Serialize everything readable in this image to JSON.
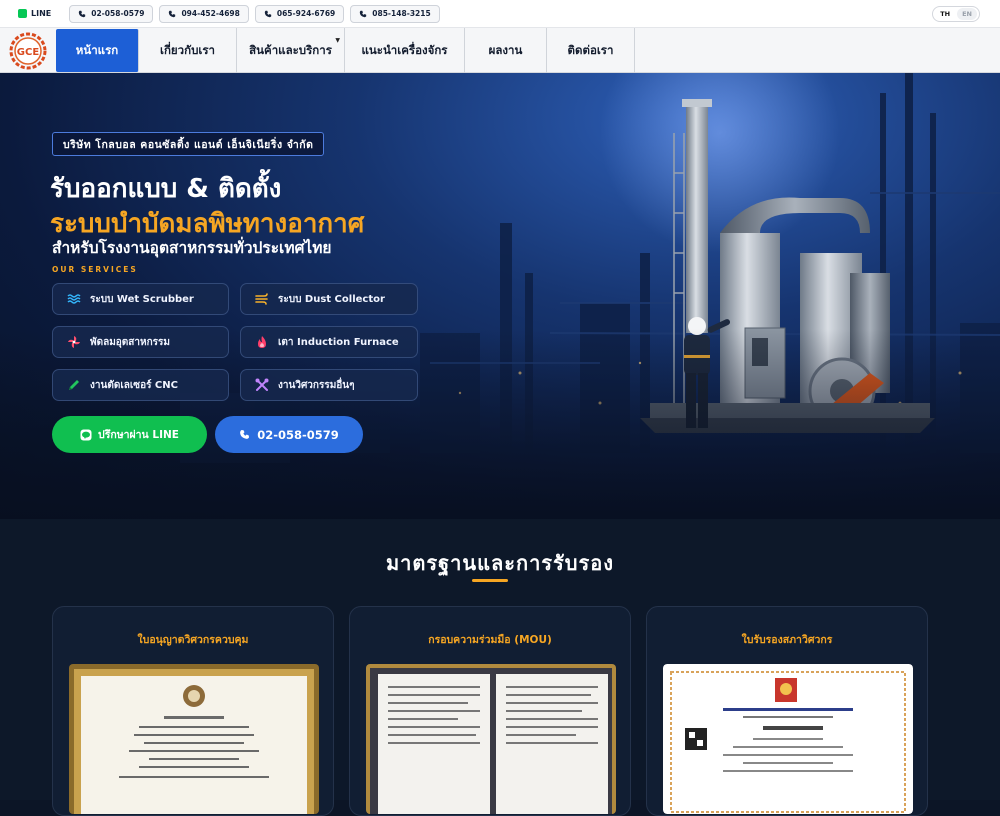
{
  "topbar": {
    "line_label": "LINE",
    "phones": [
      "02-058-0579",
      "094-452-4698",
      "065-924-6769",
      "085-148-3215"
    ],
    "lang": [
      "TH",
      "EN"
    ]
  },
  "nav": {
    "logo_text": "GCE",
    "items": [
      {
        "label": "หน้าแรก",
        "active": true
      },
      {
        "label": "เกี่ยวกับเรา"
      },
      {
        "label": "สินค้าและบริการ",
        "dropdown": true
      },
      {
        "label": "แนะนำเครื่องจักร"
      },
      {
        "label": "ผลงาน"
      },
      {
        "label": "ติดต่อเรา"
      }
    ]
  },
  "hero": {
    "company": "บริษัท โกลบอล คอนซัลติ้ง แอนด์ เอ็นจิเนียริ่ง จำกัด",
    "headline_1": "รับออกแบบ & ติดตั้ง",
    "headline_2": "ระบบบำบัดมลพิษทางอากาศ",
    "subheadline": "สำหรับโรงงานอุตสาหกรรมทั่วประเทศไทย",
    "services_label": "OUR SERVICES",
    "services": [
      {
        "label": "ระบบ Wet Scrubber",
        "icon": "water-waves-icon"
      },
      {
        "label": "ระบบ Dust Collector",
        "icon": "wind-icon"
      },
      {
        "label": "พัดลมอุตสาหกรรม",
        "icon": "fan-icon"
      },
      {
        "label": "เตา Induction Furnace",
        "icon": "fire-icon"
      },
      {
        "label": "งานตัดเลเซอร์ CNC",
        "icon": "pen-icon"
      },
      {
        "label": "งานวิศวกรรมอื่นๆ",
        "icon": "tools-icon"
      }
    ],
    "cta_line": "ปรึกษาผ่าน LINE",
    "cta_phone": "02-058-0579"
  },
  "certificates": {
    "title": "มาตรฐานและการรับรอง",
    "cards": [
      {
        "title": "ใบอนุญาตวิศวกรควบคุม"
      },
      {
        "title": "กรอบความร่วมมือ (MOU)"
      },
      {
        "title": "ใบรับรองสภาวิศวกร"
      }
    ]
  },
  "colors": {
    "accent": "#f6a623",
    "primary": "#1d5fd6",
    "line_green": "#10bf50"
  }
}
